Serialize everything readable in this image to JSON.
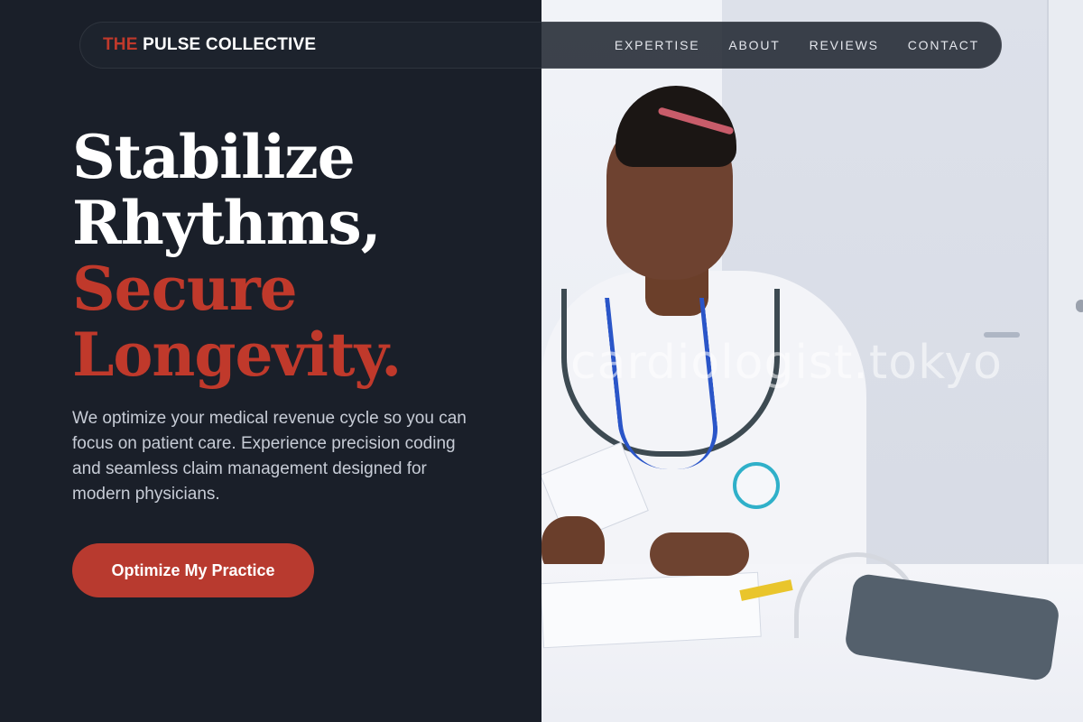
{
  "nav": {
    "brand_accent": "THE",
    "brand_rest": " PULSE COLLECTIVE",
    "links": [
      "EXPERTISE",
      "ABOUT",
      "REVIEWS",
      "CONTACT"
    ]
  },
  "hero": {
    "line1": "Stabilize",
    "line2": "Rhythms,",
    "line3": "Secure",
    "line4": "Longevity.",
    "subtext": "We optimize your medical revenue cycle so you can focus on patient care. Experience precision coding and seamless claim management designed for modern physicians.",
    "cta_label": "Optimize My Practice"
  },
  "photo": {
    "watermark": "cardiologist.tokyo"
  },
  "colors": {
    "background": "#1a1f29",
    "accent": "#c0392b",
    "button": "#b83a2f",
    "text_primary": "#ffffff",
    "text_secondary": "#c7ccd6"
  }
}
